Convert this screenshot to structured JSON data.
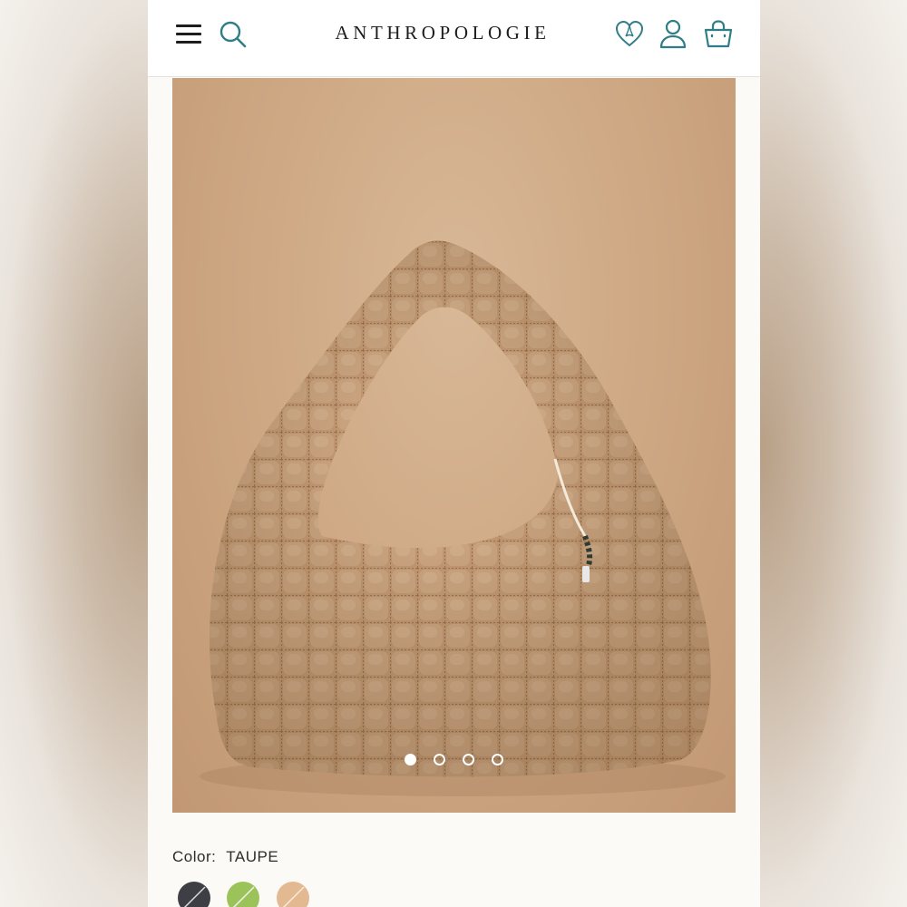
{
  "brand": {
    "name": "ANTHROPOLOGIE"
  },
  "header": {
    "icons": [
      "menu-icon",
      "search-icon",
      "heart-icon",
      "user-icon",
      "bag-icon"
    ],
    "accent_color": "#2f7d86"
  },
  "gallery": {
    "image_count": 4,
    "active_index": 1
  },
  "product": {
    "color_label": "Color:",
    "color_value": "TAUPE",
    "swatches": [
      {
        "name": "charcoal",
        "color": "#3d3f45"
      },
      {
        "name": "lime",
        "color": "#9cc35a"
      },
      {
        "name": "taupe",
        "color": "#e2b990"
      }
    ]
  }
}
